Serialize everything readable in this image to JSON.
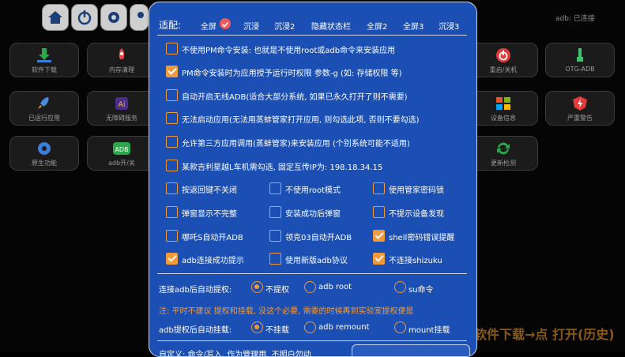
{
  "status": {
    "adb": "adb: 已连接"
  },
  "top_icons": [
    "home-icon",
    "power-icon",
    "gear-icon",
    "user-icon"
  ],
  "tiles": {
    "software_download": "软件下载",
    "memory_clean": "内存清理",
    "restart_shutdown": "重启/关机",
    "otg_adb": "OTG-ADB",
    "running_apps": "已运行应用",
    "accessibility": "无障碍服务",
    "device_info": "设备信息",
    "severe_warning": "严重警告",
    "native_function": "原生功能",
    "adb_toggle": "adb开/关",
    "update_check": "更新检测"
  },
  "background_hint": "软件下载→点 打开(历史)",
  "dialog": {
    "title": "适配:",
    "modes": [
      "全屏",
      "沉浸",
      "沉浸2",
      "隐藏状态栏",
      "全屏2",
      "全屏3",
      "沉浸3"
    ],
    "selected_mode": "全屏",
    "options": [
      {
        "label": "不使用PM命令安装: 也就是不使用root或adb命令来安装应用",
        "checked": false
      },
      {
        "label": "PM命令安装时为应用授予运行时权限 参数-g (如: 存储权限 等)",
        "checked": true
      },
      {
        "label": "自动开启无线ADB(适合大部分系统, 如果已永久打开了则不需要)",
        "checked": false
      },
      {
        "label": "无法启动应用(无法用蒸蚌管家打开应用, 则勾选此项, 否则不要勾选)",
        "checked": false
      },
      {
        "label": "允许第三方应用调用(蒸蚌管家)来安装应用 (个别系统可能不适用)",
        "checked": false
      },
      {
        "label": "某款吉利星越L车机需勾选, 固定互传IP为: 198.18.34.15",
        "checked": false
      }
    ],
    "grid": [
      {
        "label": "按返回键不关闭",
        "checked": false
      },
      {
        "label": "不使用root模式",
        "checked": false
      },
      {
        "label": "使用管家密码锁",
        "checked": false
      },
      {
        "label": "弹窗显示不完整",
        "checked": false
      },
      {
        "label": "安装成功后弹窗",
        "checked": false
      },
      {
        "label": "不提示设备发现",
        "checked": false
      },
      {
        "label": "哪吒S自动开ADB",
        "checked": false
      },
      {
        "label": "领克03自动开ADB",
        "checked": false
      },
      {
        "label": "shell密码错误提醒",
        "checked": true
      },
      {
        "label": "adb连接成功提示",
        "checked": true
      },
      {
        "label": "使用新版adb协议",
        "checked": false
      },
      {
        "label": "不连接shizuku",
        "checked": true
      }
    ],
    "auto_privilege": {
      "label": "连接adb后自动提权:",
      "options": [
        "不提权",
        "adb root",
        "su命令"
      ],
      "selected": "不提权"
    },
    "note": "注: 平时不建议 提权和挂载, 没这个必要, 需要的时候再到实验室提权便是",
    "auto_mount": {
      "label": "adb提权后自动挂载:",
      "options": [
        "不挂载",
        "adb remount",
        "mount挂载"
      ],
      "selected": "不挂载"
    },
    "bottom_text": "自定义: 命令/写入. 作为管理用. 不明白勿动"
  },
  "colors": {
    "dialog": "#1b4fb4",
    "accent": "#f29a3a",
    "heart": "#ef5a5a"
  }
}
